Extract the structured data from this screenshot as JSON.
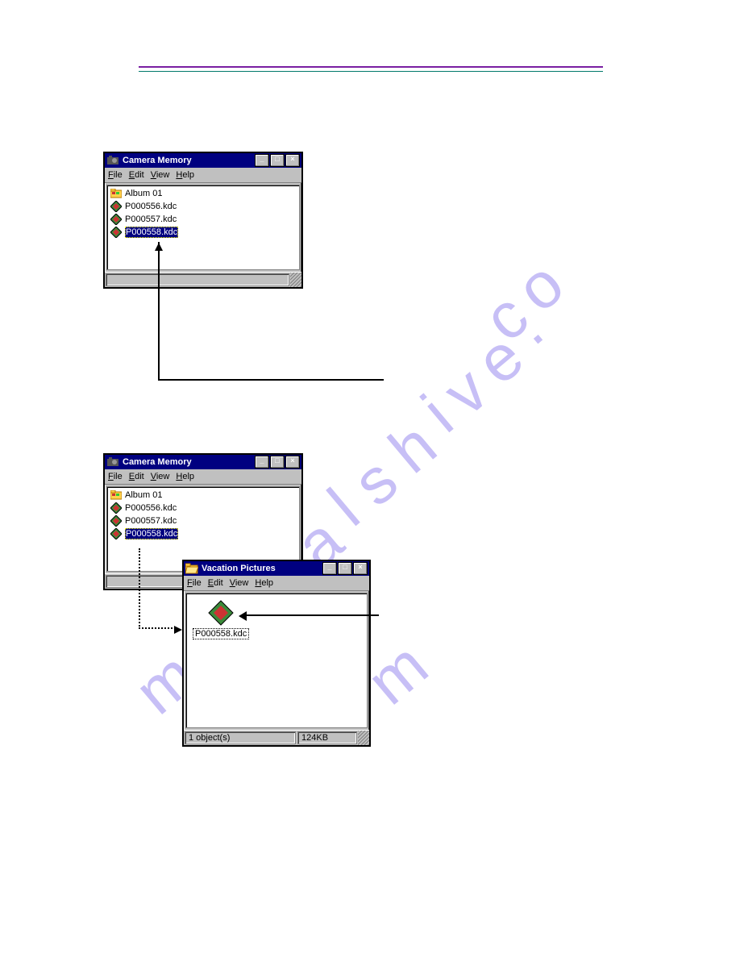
{
  "window1": {
    "title": "Camera Memory",
    "menu": [
      "File",
      "Edit",
      "View",
      "Help"
    ],
    "items": [
      {
        "name": "Album  01",
        "type": "folder"
      },
      {
        "name": "P000556.kdc",
        "type": "kdc"
      },
      {
        "name": "P000557.kdc",
        "type": "kdc"
      },
      {
        "name": "P000558.kdc",
        "type": "kdc",
        "selected": true
      }
    ]
  },
  "window2": {
    "title": "Camera Memory",
    "menu": [
      "File",
      "Edit",
      "View",
      "Help"
    ],
    "items": [
      {
        "name": "Album  01",
        "type": "folder"
      },
      {
        "name": "P000556.kdc",
        "type": "kdc"
      },
      {
        "name": "P000557.kdc",
        "type": "kdc"
      },
      {
        "name": "P000558.kdc",
        "type": "kdc",
        "selected": true
      }
    ]
  },
  "window3": {
    "title": "Vacation Pictures",
    "menu": [
      "File",
      "Edit",
      "View",
      "Help"
    ],
    "thumb_label": "P000558.kdc",
    "status_left": "1 object(s)",
    "status_right": "124KB"
  },
  "watermark_text": "manualshive.com"
}
